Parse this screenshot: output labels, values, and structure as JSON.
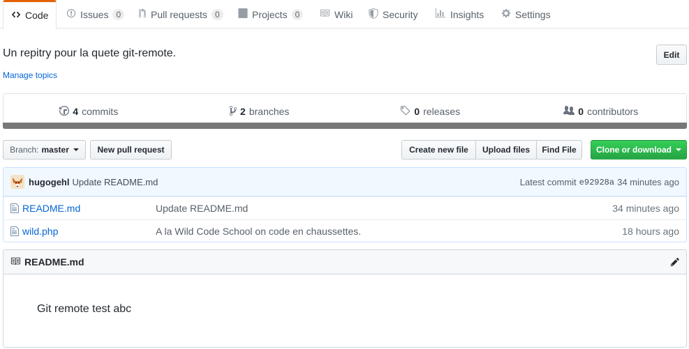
{
  "tabs": [
    {
      "label": "Code",
      "icon": "code-icon",
      "selected": true
    },
    {
      "label": "Issues",
      "icon": "issue-icon",
      "count": "0"
    },
    {
      "label": "Pull requests",
      "icon": "pull-request-icon",
      "count": "0"
    },
    {
      "label": "Projects",
      "icon": "project-icon",
      "count": "0"
    },
    {
      "label": "Wiki",
      "icon": "book-icon"
    },
    {
      "label": "Security",
      "icon": "shield-icon"
    },
    {
      "label": "Insights",
      "icon": "graph-icon"
    },
    {
      "label": "Settings",
      "icon": "gear-icon"
    }
  ],
  "repo": {
    "description": "Un repitry pour la quete git-remote.",
    "manage_topics": "Manage topics",
    "edit_label": "Edit"
  },
  "summary": {
    "commits": {
      "count": "4",
      "label": "commits"
    },
    "branches": {
      "count": "2",
      "label": "branches"
    },
    "releases": {
      "count": "0",
      "label": "releases"
    },
    "contributors": {
      "count": "0",
      "label": "contributors"
    }
  },
  "file_nav": {
    "branch_prefix": "Branch:",
    "branch_name": "master",
    "new_pr": "New pull request",
    "create_file": "Create new file",
    "upload_files": "Upload files",
    "find_file": "Find File",
    "clone": "Clone or download"
  },
  "commit": {
    "author": "hugogehl",
    "message": "Update README.md",
    "latest_label": "Latest commit",
    "sha": "e92928a",
    "age": "34 minutes ago"
  },
  "files": [
    {
      "name": "README.md",
      "message": "Update README.md",
      "age": "34 minutes ago"
    },
    {
      "name": "wild.php",
      "message": "A la Wild Code School on code en chaussettes.",
      "age": "18 hours ago"
    }
  ],
  "readme": {
    "title": "README.md",
    "body": "Git remote test abc"
  },
  "colors": {
    "accent": "#e36209",
    "link": "#0366d6",
    "clone_green": "#28a745",
    "language_bar": "#777777"
  }
}
